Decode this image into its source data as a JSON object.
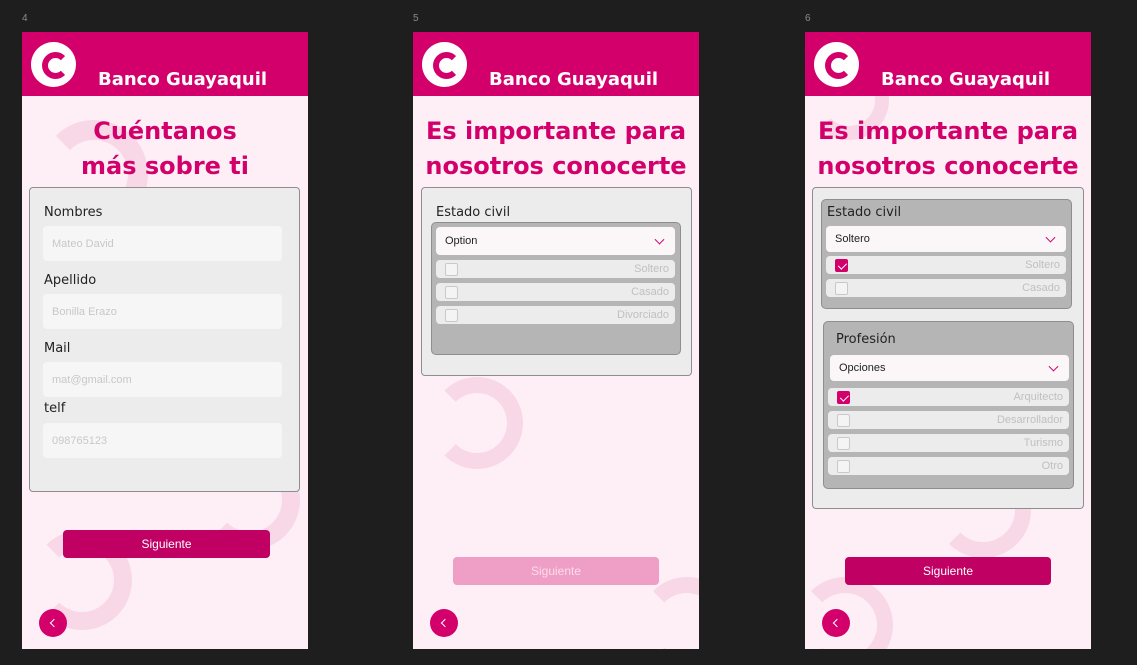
{
  "screens": [
    {
      "number": "4",
      "brand": "Banco Guayaquil",
      "title_line1": "Cuéntanos",
      "title_line2": "más sobre ti",
      "fields": [
        {
          "label": "Nombres",
          "placeholder": "Mateo David"
        },
        {
          "label": "Apellido",
          "placeholder": "Bonilla Erazo"
        },
        {
          "label": "Mail",
          "placeholder": "mat@gmail.com"
        },
        {
          "label": "telf",
          "placeholder": "098765123"
        }
      ],
      "next_label": "Siguiente"
    },
    {
      "number": "5",
      "brand": "Banco Guayaquil",
      "title_line1": "Es importante para",
      "title_line2": "nosotros conocerte",
      "civil": {
        "label": "Estado civil",
        "select_value": "Option",
        "options": [
          {
            "label": "Soltero",
            "checked": false
          },
          {
            "label": "Casado",
            "checked": false
          },
          {
            "label": "Divorciado",
            "checked": false
          }
        ]
      },
      "next_label": "Siguiente",
      "next_enabled": false
    },
    {
      "number": "6",
      "brand": "Banco Guayaquil",
      "title_line1": "Es importante para",
      "title_line2": "nosotros conocerte",
      "civil": {
        "label": "Estado civil",
        "select_value": "Soltero",
        "options": [
          {
            "label": "Soltero",
            "checked": true
          },
          {
            "label": "Casado",
            "checked": false
          }
        ]
      },
      "profession": {
        "label": "Profesión",
        "select_value": "Opciones",
        "options": [
          {
            "label": "Arquitecto",
            "checked": true
          },
          {
            "label": "Desarrollador",
            "checked": false
          },
          {
            "label": "Turismo",
            "checked": false
          },
          {
            "label": "Otro",
            "checked": false
          }
        ]
      },
      "next_label": "Siguiente",
      "next_enabled": true
    }
  ],
  "colors": {
    "brand": "#d3006c",
    "background": "#fdeff5",
    "button": "#c10064",
    "button_disabled": "#ef9ec6"
  },
  "icons": [
    "bank-logo-icon",
    "chevron-down-icon",
    "checkmark-icon",
    "back-arrow-icon"
  ]
}
